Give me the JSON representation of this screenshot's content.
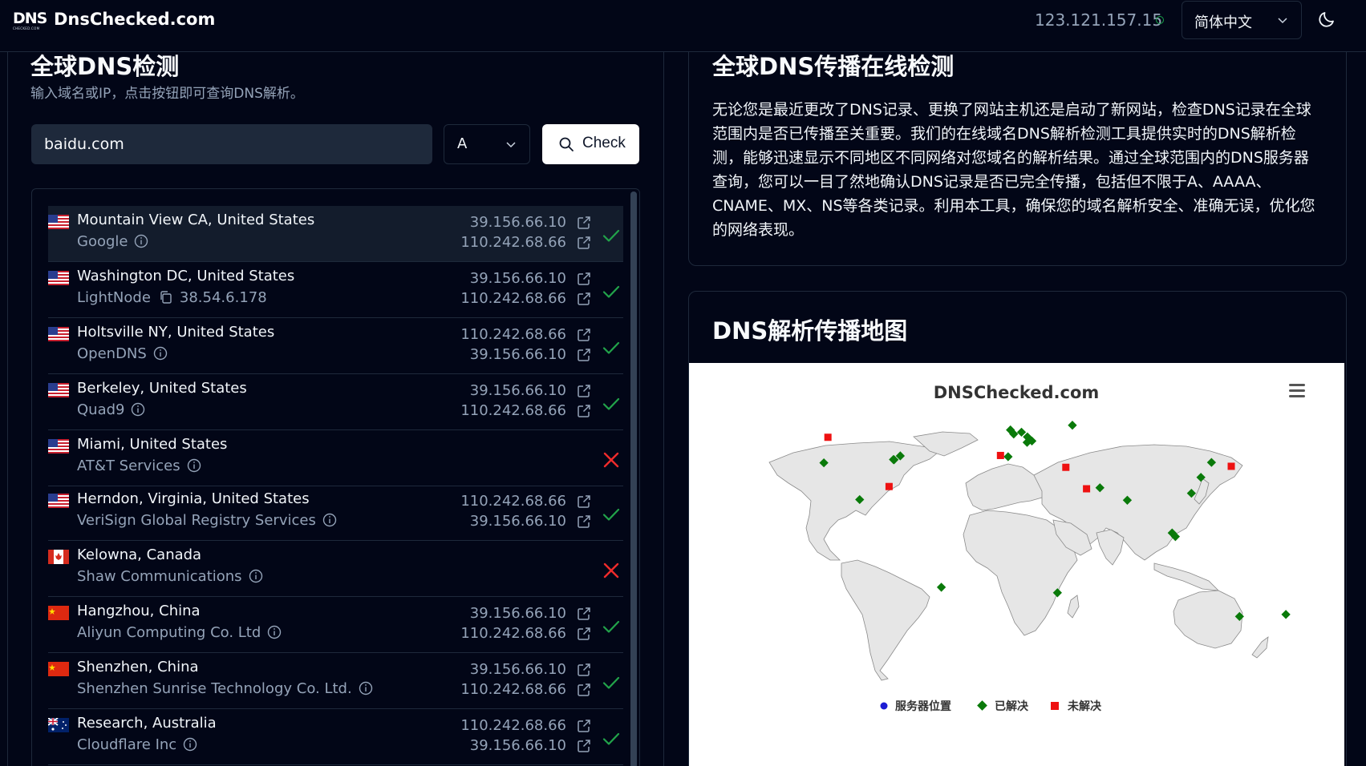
{
  "header": {
    "logo_text": "DNS",
    "logo_subtext": "CHECKED.COM",
    "brand": "DnsChecked.com",
    "client_ip": "123.121.157.15",
    "language": "简体中文"
  },
  "checker": {
    "title": "全球DNS检测",
    "subtitle": "输入域名或IP，点击按钮即可查询DNS解析。",
    "domain_value": "baidu.com",
    "record_type": "A",
    "check_label": "Check"
  },
  "results": [
    {
      "location": "Mountain View CA, United States",
      "provider": "Google",
      "flag": "us",
      "ips": [
        "39.156.66.10",
        "110.242.68.66"
      ],
      "status": "resolved"
    },
    {
      "location": "Washington DC, United States",
      "provider": "LightNode",
      "server_ip": "38.54.6.178",
      "flag": "us",
      "ips": [
        "39.156.66.10",
        "110.242.68.66"
      ],
      "status": "resolved"
    },
    {
      "location": "Holtsville NY, United States",
      "provider": "OpenDNS",
      "flag": "us",
      "ips": [
        "110.242.68.66",
        "39.156.66.10"
      ],
      "status": "resolved"
    },
    {
      "location": "Berkeley, United States",
      "provider": "Quad9",
      "flag": "us",
      "ips": [
        "39.156.66.10",
        "110.242.68.66"
      ],
      "status": "resolved"
    },
    {
      "location": "Miami, United States",
      "provider": "AT&T Services",
      "flag": "us",
      "ips": [
        "",
        ""
      ],
      "status": "failed"
    },
    {
      "location": "Herndon, Virginia, United States",
      "provider": "VeriSign Global Registry Services",
      "flag": "us",
      "ips": [
        "110.242.68.66",
        "39.156.66.10"
      ],
      "status": "resolved"
    },
    {
      "location": "Kelowna, Canada",
      "provider": "Shaw Communications",
      "flag": "ca",
      "ips": [
        "",
        ""
      ],
      "status": "failed"
    },
    {
      "location": "Hangzhou, China",
      "provider": "Aliyun Computing Co. Ltd",
      "flag": "cn",
      "ips": [
        "39.156.66.10",
        "110.242.68.66"
      ],
      "status": "resolved"
    },
    {
      "location": "Shenzhen, China",
      "provider": "Shenzhen Sunrise Technology Co. Ltd.",
      "flag": "cn",
      "ips": [
        "39.156.66.10",
        "110.242.68.66"
      ],
      "status": "resolved"
    },
    {
      "location": "Research, Australia",
      "provider": "Cloudflare Inc",
      "flag": "au",
      "ips": [
        "110.242.68.66",
        "39.156.66.10"
      ],
      "status": "resolved"
    }
  ],
  "about": {
    "title": "全球DNS传播在线检测",
    "body": "无论您是最近更改了DNS记录、更换了网站主机还是启动了新网站，检查DNS记录在全球范围内是否已传播至关重要。我们的在线域名DNS解析检测工具提供实时的DNS解析检测，能够迅速显示不同地区不同网络对您域名的解析结果。通过全球范围内的DNS服务器查询，您可以一目了然地确认DNS记录是否已完全传播，包括但不限于A、AAAA、CNAME、MX、NS等各类记录。利用本工具，确保您的域名解析安全、准确无误，优化您的网络表现。"
  },
  "map": {
    "title": "DNS解析传播地图",
    "chart_title": "DNSChecked.com",
    "legend": {
      "server": "服务器位置",
      "resolved": "已解决",
      "unresolved": "未解决"
    },
    "colors": {
      "server": "#1d1dd4",
      "resolved": "#0a7a0a",
      "unresolved": "#ee1111",
      "land": "#e6e6e6"
    },
    "markers": {
      "resolved": [
        {
          "lat": 37.4,
          "lon": -122.1
        },
        {
          "lat": 38.9,
          "lon": -77.0
        },
        {
          "lat": 40.8,
          "lon": -73.0
        },
        {
          "lat": 39.0,
          "lon": -77.4
        },
        {
          "lat": 19.4,
          "lon": -99.1
        },
        {
          "lat": -23.5,
          "lon": -46.6
        },
        {
          "lat": 53.5,
          "lon": -2.2
        },
        {
          "lat": 51.5,
          "lon": -0.1
        },
        {
          "lat": 52.4,
          "lon": 4.9
        },
        {
          "lat": 50.1,
          "lon": 8.7
        },
        {
          "lat": 48.1,
          "lon": 11.6
        },
        {
          "lat": 47.4,
          "lon": 8.5
        },
        {
          "lat": 40.4,
          "lon": -3.7
        },
        {
          "lat": 55.8,
          "lon": 37.6
        },
        {
          "lat": 25.2,
          "lon": 55.3
        },
        {
          "lat": 19.1,
          "lon": 72.9
        },
        {
          "lat": 30.3,
          "lon": 120.2
        },
        {
          "lat": 22.5,
          "lon": 114.1
        },
        {
          "lat": 37.6,
          "lon": 127.0
        },
        {
          "lat": 1.3,
          "lon": 103.8
        },
        {
          "lat": 3.1,
          "lon": 101.7
        },
        {
          "lat": -26.2,
          "lon": 28.0
        },
        {
          "lat": -37.8,
          "lon": 145.0
        },
        {
          "lat": -36.8,
          "lon": 174.8
        }
      ],
      "unresolved": [
        {
          "lat": 49.9,
          "lon": -119.5
        },
        {
          "lat": 25.8,
          "lon": -80.2
        },
        {
          "lat": 41.0,
          "lon": -8.6
        },
        {
          "lat": 35.2,
          "lon": 33.4
        },
        {
          "lat": 24.7,
          "lon": 46.7
        },
        {
          "lat": 35.7,
          "lon": 139.7
        }
      ]
    }
  }
}
